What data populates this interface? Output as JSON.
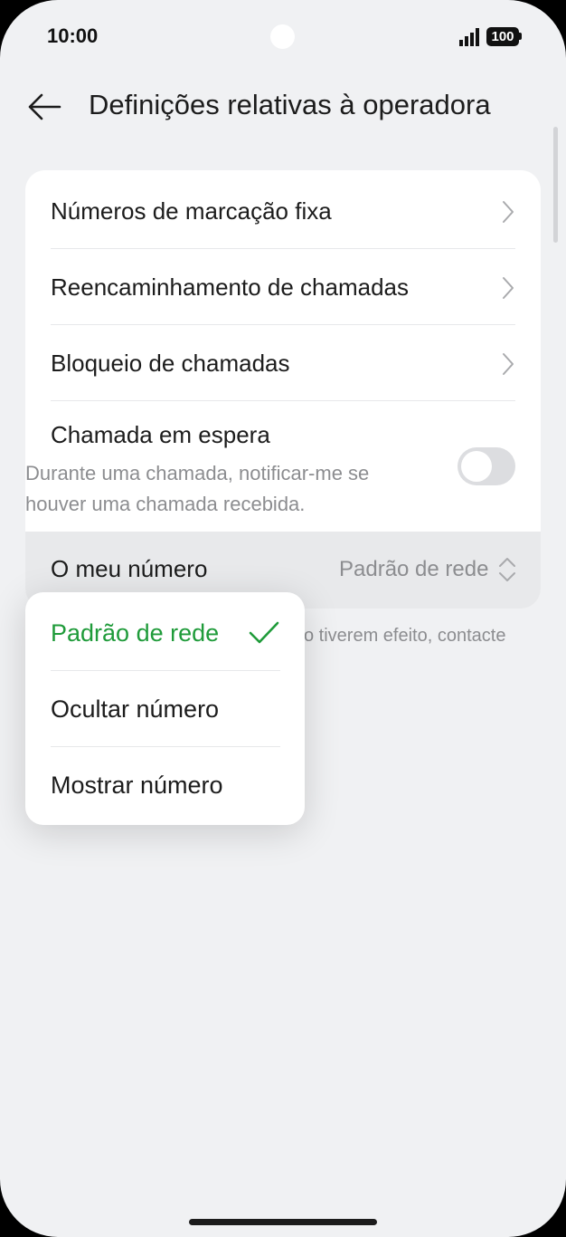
{
  "status_bar": {
    "time": "10:00",
    "battery": "100"
  },
  "header": {
    "title": "Definições relativas à operadora"
  },
  "settings": {
    "fixed_dialing": "Números de marcação fixa",
    "call_forwarding": "Reencaminhamento de chamadas",
    "call_barring": "Bloqueio de chamadas",
    "call_waiting": {
      "title": "Chamada em espera",
      "description": "Durante uma chamada, notificar-me se houver uma chamada recebida.",
      "enabled": false
    },
    "my_number": {
      "label": "O meu número",
      "value": "Padrão de rede"
    }
  },
  "footnote": "o tiverem efeito, contacte",
  "dropdown": {
    "options": [
      {
        "label": "Padrão de rede",
        "selected": true
      },
      {
        "label": "Ocultar número",
        "selected": false
      },
      {
        "label": "Mostrar número",
        "selected": false
      }
    ]
  },
  "colors": {
    "accent": "#1f9b3a",
    "background": "#f0f1f3"
  }
}
